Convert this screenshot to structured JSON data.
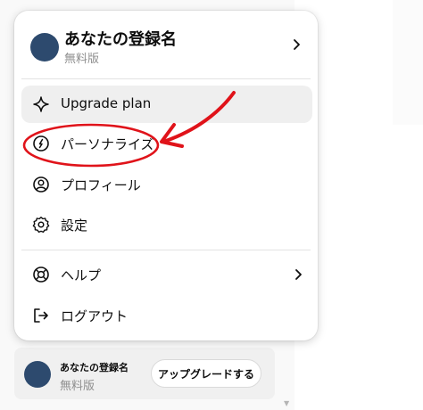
{
  "account": {
    "name": "あなたの登録名",
    "plan": "無料版"
  },
  "menu": {
    "items": [
      {
        "label": "Upgrade plan",
        "icon": "sparkle-icon"
      },
      {
        "label": "パーソナライズ",
        "icon": "personalize-icon"
      },
      {
        "label": "プロフィール",
        "icon": "profile-icon"
      },
      {
        "label": "設定",
        "icon": "gear-icon"
      },
      {
        "label": "ヘルプ",
        "icon": "lifebuoy-icon"
      },
      {
        "label": "ログアウト",
        "icon": "logout-icon"
      }
    ]
  },
  "bottom_bar": {
    "name": "あなたの登録名",
    "plan": "無料版",
    "upgrade_label": "アップグレードする"
  },
  "colors": {
    "annotation_red": "#e0131a",
    "hover_background": "#efefef",
    "avatar": "#2d4a6e"
  }
}
